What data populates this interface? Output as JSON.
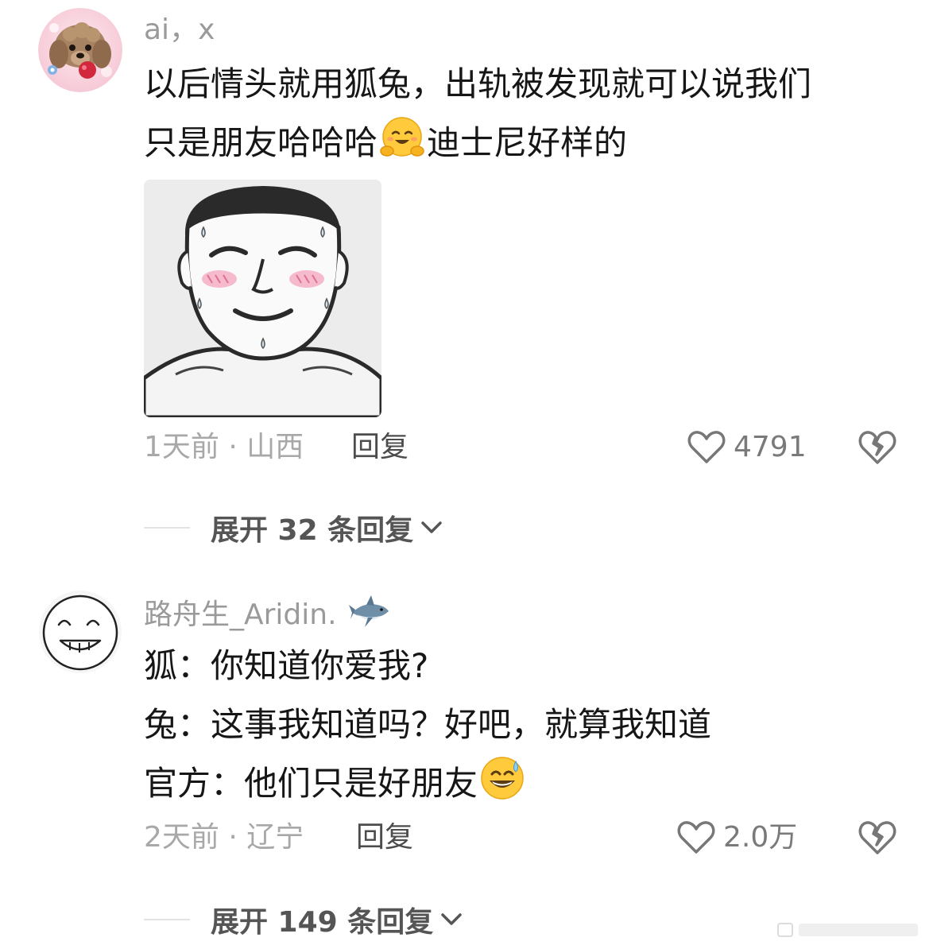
{
  "comments": [
    {
      "username": "ai，x",
      "avatar_icon": "poodle-avatar",
      "lines": [
        {
          "before": "以后情头就用狐兔，出轨被发现就可以说我们",
          "emoji": "",
          "after": ""
        },
        {
          "before": "只是朋友哈哈哈",
          "emoji": "hugging-face-emoji",
          "after": "迪士尼好样的"
        }
      ],
      "sticker_icon": "meme-sticker-blushing-man",
      "time": "1天前",
      "location": "山西",
      "reply_label": "回复",
      "likes": "4791",
      "expand_label": "展开 32 条回复"
    },
    {
      "username": "路舟生_Aridin.",
      "username_icon": "shark-emoji",
      "avatar_icon": "smiley-doodle-avatar",
      "lines": [
        {
          "before": "狐：你知道你爱我?",
          "emoji": "",
          "after": ""
        },
        {
          "before": "兔：这事我知道吗？好吧，就算我知道",
          "emoji": "",
          "after": ""
        },
        {
          "before": "官方：他们只是好朋友",
          "emoji": "grinning-sweat-emoji",
          "after": ""
        }
      ],
      "time": "2天前",
      "location": "辽宁",
      "reply_label": "回复",
      "likes": "2.0万",
      "expand_label": "展开 149 条回复"
    }
  ],
  "meta_separator": " · ",
  "colors": {
    "username": "#9a9a9a",
    "body_text": "#161616",
    "meta": "#a8a8a8",
    "expand_text": "#555555"
  }
}
